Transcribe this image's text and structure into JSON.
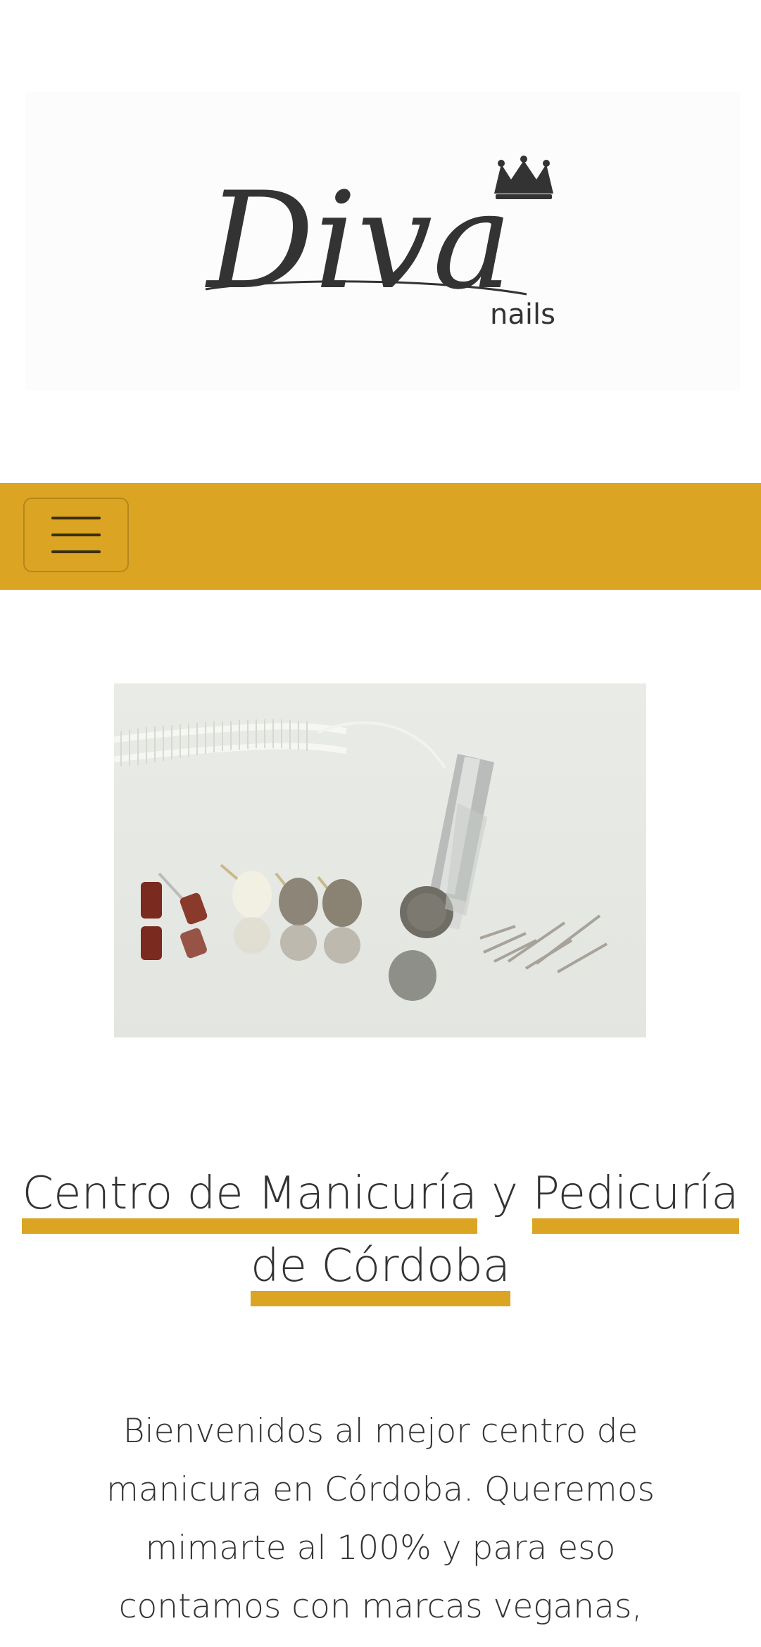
{
  "logo": {
    "script_text": "Diva",
    "sub_text": "nails"
  },
  "nav": {
    "menu_icon": "hamburger-icon"
  },
  "hero": {
    "icon": "nail-drill-photo"
  },
  "heading": {
    "part1": "Centro de Manicuría",
    "connector": " y ",
    "part2": "Pedicuría",
    "part3": "de Córdoba"
  },
  "intro": {
    "text": "Bienvenidos al mejor centro de manicura en Córdoba. Queremos mimarte al 100% y para eso contamos con marcas veganas, no"
  },
  "colors": {
    "accent": "#dba523",
    "text": "#333333",
    "background": "#ffffff"
  }
}
